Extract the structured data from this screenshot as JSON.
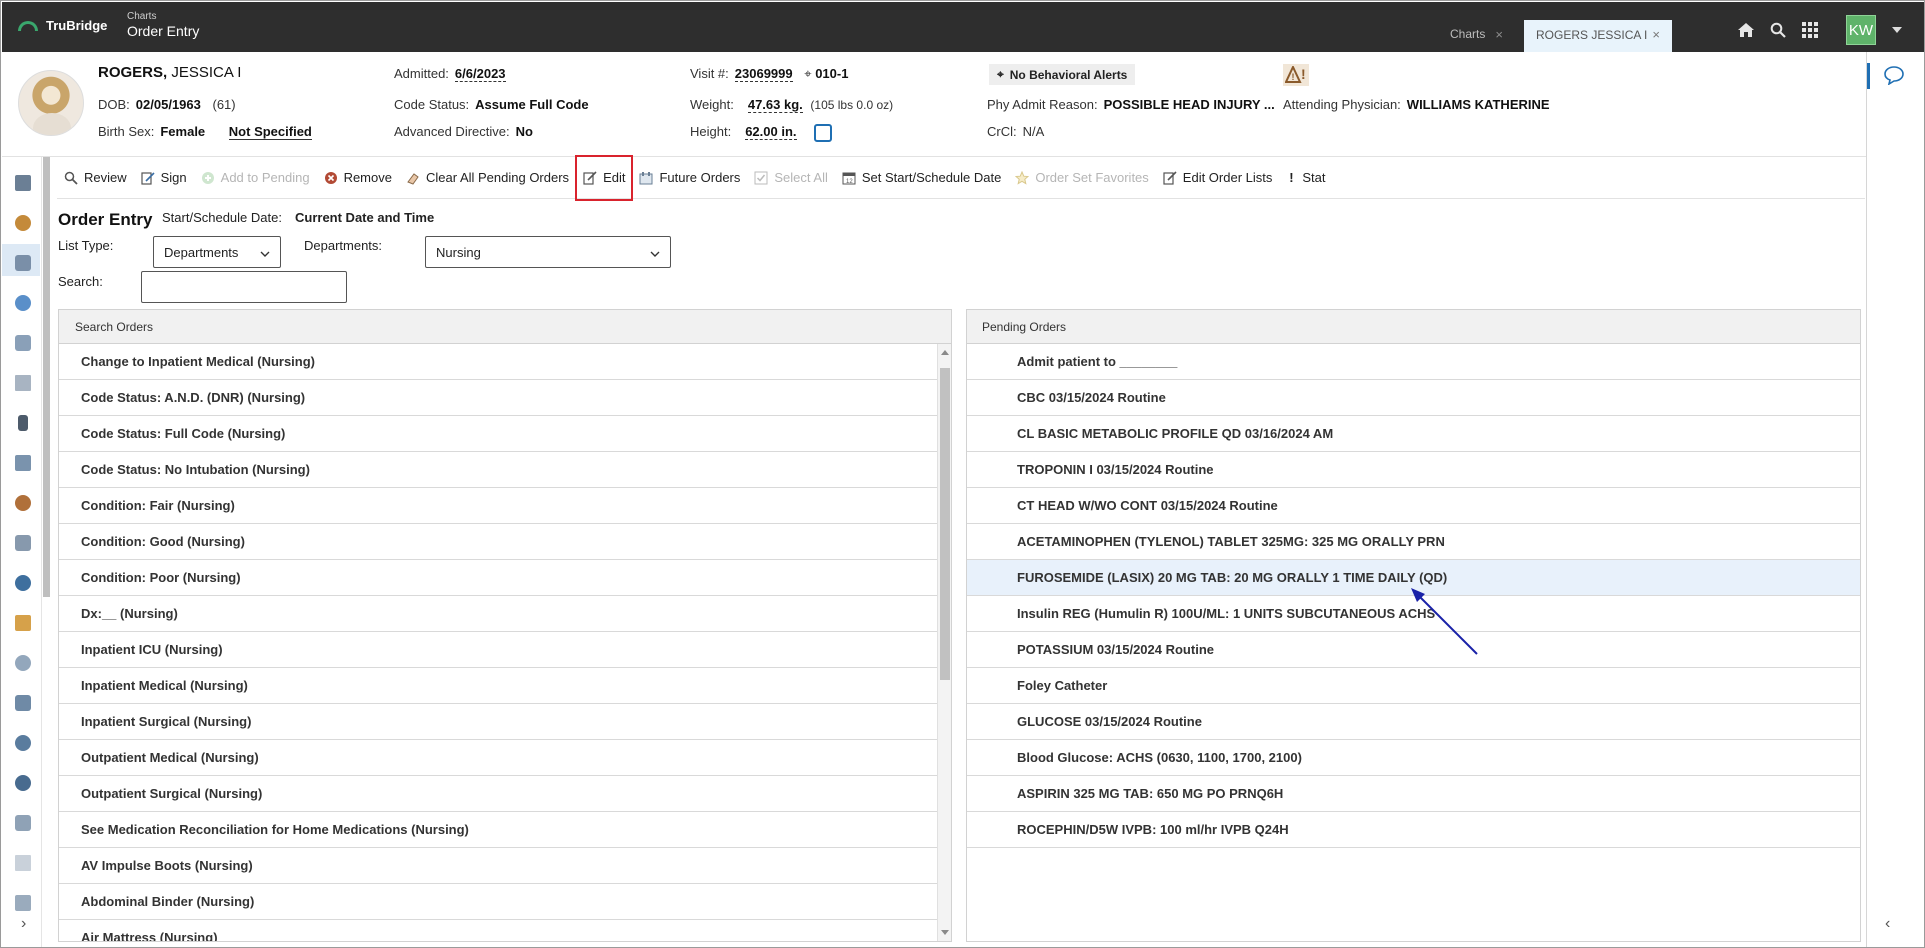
{
  "topbar": {
    "logo_text": "TruBridge",
    "app_small": "Charts",
    "app_big": "Order Entry",
    "tabs": [
      {
        "label": "Charts",
        "close": "×"
      },
      {
        "label": "ROGERS JESSICA I",
        "close": "×"
      }
    ],
    "user_initials": "KW",
    "icons": [
      "home-icon",
      "search-icon",
      "apps-grid-icon"
    ]
  },
  "patient": {
    "last_name": "ROGERS,",
    "first_name": " JESSICA I",
    "dob_label": "DOB:",
    "dob": "02/05/1963",
    "age": "(61)",
    "birth_sex_label": "Birth Sex:",
    "birth_sex": "Female",
    "gender_identity": "Not Specified",
    "admitted_label": "Admitted:",
    "admitted": "6/6/2023",
    "code_status_label": "Code Status:",
    "code_status": "Assume Full Code",
    "adv_directive_label": "Advanced Directive:",
    "adv_directive": "No",
    "visit_label": "Visit #:",
    "visit": "23069999",
    "room": "010-1",
    "weight_label": "Weight:",
    "weight": "47.63 kg.",
    "weight_alt": "(105 lbs 0.0 oz)",
    "height_label": "Height:",
    "height": "62.00 in.",
    "behavioral_alert": "No Behavioral Alerts",
    "phy_admit_label": "Phy Admit Reason:",
    "phy_admit": "POSSIBLE HEAD INJURY ...",
    "crcl_label": "CrCl:",
    "crcl": "N/A",
    "attending_label": "Attending Physician:",
    "attending": "WILLIAMS KATHERINE"
  },
  "toolbar": {
    "review": "Review",
    "sign": "Sign",
    "add_pending": "Add to Pending",
    "remove": "Remove",
    "clear_all": "Clear All Pending Orders",
    "edit": "Edit",
    "future_orders": "Future Orders",
    "select_all": "Select All",
    "set_start": "Set Start/Schedule Date",
    "favorites": "Order Set Favorites",
    "edit_lists": "Edit Order Lists",
    "stat": "Stat"
  },
  "order_entry": {
    "title": "Order Entry",
    "schedule_label": "Start/Schedule Date:",
    "schedule_value": "Current Date and Time",
    "list_type_label": "List Type:",
    "list_type_value": "Departments",
    "departments_label": "Departments:",
    "departments_value": "Nursing",
    "search_label": "Search:",
    "search_value": ""
  },
  "search_orders": {
    "header": "Search Orders",
    "items": [
      "Change to Inpatient Medical (Nursing)",
      "Code Status: A.N.D. (DNR) (Nursing)",
      "Code Status: Full Code (Nursing)",
      "Code Status: No Intubation (Nursing)",
      "Condition: Fair (Nursing)",
      "Condition: Good (Nursing)",
      "Condition: Poor (Nursing)",
      "Dx:__ (Nursing)",
      "Inpatient ICU (Nursing)",
      "Inpatient Medical (Nursing)",
      "Inpatient Surgical (Nursing)",
      "Outpatient Medical (Nursing)",
      "Outpatient Surgical (Nursing)",
      "See Medication Reconciliation for Home Medications (Nursing)",
      "AV Impulse Boots (Nursing)",
      "Abdominal Binder (Nursing)",
      "Air Mattress (Nursing)"
    ]
  },
  "pending_orders": {
    "header": "Pending Orders",
    "items": [
      "Admit patient to ________",
      "CBC 03/15/2024 Routine",
      "CL BASIC METABOLIC PROFILE QD 03/16/2024 AM",
      "TROPONIN I 03/15/2024 Routine",
      "CT HEAD W/WO CONT 03/15/2024 Routine",
      "ACETAMINOPHEN (TYLENOL) TABLET 325MG: 325 MG ORALLY PRN",
      "FUROSEMIDE (LASIX) 20 MG TAB: 20 MG ORALLY 1 TIME DAILY (QD)",
      "Insulin REG (Humulin R) 100U/ML: 1 UNITS SUBCUTANEOUS ACHS",
      "POTASSIUM 03/15/2024 Routine",
      "Foley Catheter",
      "GLUCOSE 03/15/2024 Routine",
      "Blood Glucose: ACHS (0630, 1100, 1700, 2100)",
      "ASPIRIN 325 MG TAB: 650 MG PO PRNQ6H",
      "ROCEPHIN/D5W IVPB: 100 ml/hr IVPB Q24H"
    ],
    "selected_index": 6
  },
  "colors": {
    "topbar": "#2e2e2e",
    "accent_green": "#3aa76d",
    "selected_row": "#e8f1fb",
    "highlight_red": "#d9232d",
    "arrow_blue": "#1a22a8"
  }
}
